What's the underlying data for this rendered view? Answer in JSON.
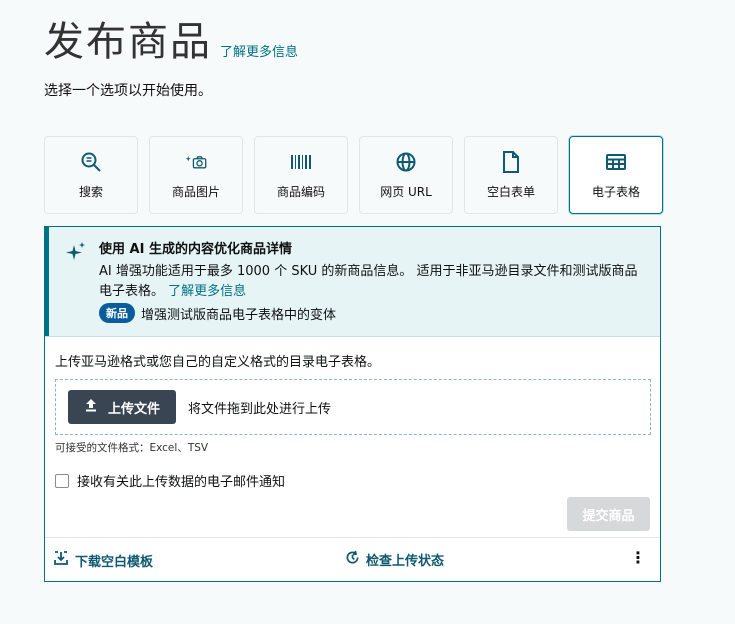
{
  "header": {
    "title": "发布商品",
    "learn_more": "了解更多信息",
    "subtitle": "选择一个选项以开始使用。"
  },
  "options": [
    {
      "label": "搜索",
      "icon": "search-icon"
    },
    {
      "label": "商品图片",
      "icon": "camera-sparkle-icon"
    },
    {
      "label": "商品编码",
      "icon": "barcode-icon"
    },
    {
      "label": "网页 URL",
      "icon": "globe-icon"
    },
    {
      "label": "空白表单",
      "icon": "document-icon"
    },
    {
      "label": "电子表格",
      "icon": "spreadsheet-icon",
      "selected": true
    }
  ],
  "ai_banner": {
    "title": "使用 AI 生成的内容优化商品详情",
    "desc": "AI 增强功能适用于最多 1000 个 SKU 的新商品信息。 适用于非亚马逊目录文件和测试版商品电子表格。",
    "link": "了解更多信息",
    "badge": "新品",
    "badge_text": "增强测试版商品电子表格中的变体"
  },
  "upload": {
    "intro": "上传亚马逊格式或您自己的自定义格式的目录电子表格。",
    "button": "上传文件",
    "drop_text": "将文件拖到此处进行上传",
    "formats": "可接受的文件格式：Excel、TSV"
  },
  "notify_label": "接收有关此上传数据的电子邮件通知",
  "submit_label": "提交商品",
  "footer": {
    "download": "下载空白模板",
    "check_status": "检查上传状态"
  },
  "colors": {
    "accent": "#007185",
    "banner_bg": "#e6f4f5",
    "upload_button": "#3a4553",
    "badge": "#0a5d9d"
  }
}
